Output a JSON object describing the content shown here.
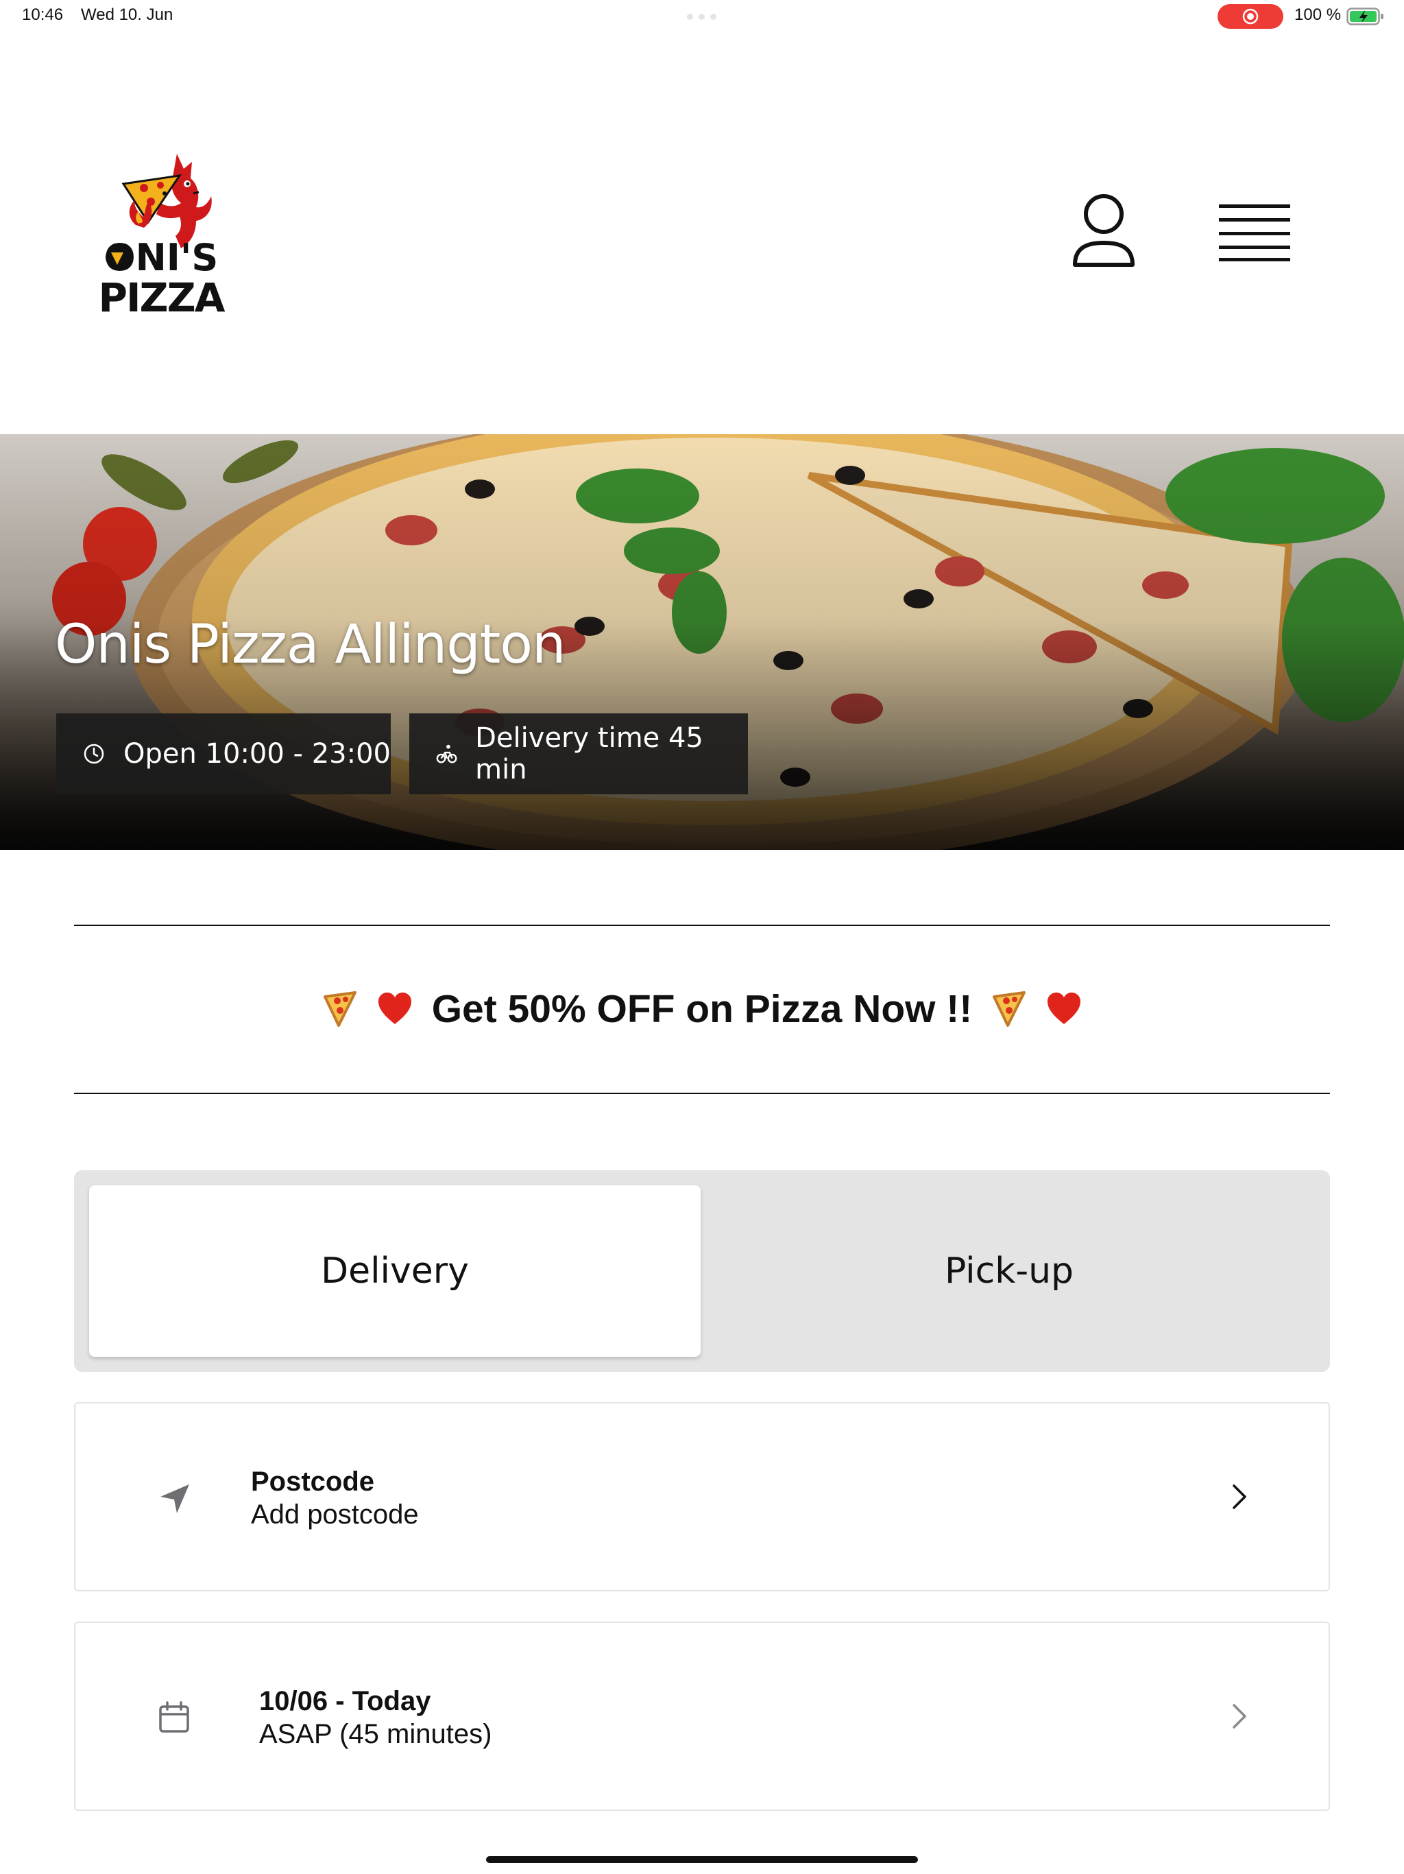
{
  "status_bar": {
    "time": "10:46",
    "date": "Wed 10. Jun",
    "battery": "100 %",
    "recording_color": "#ef3b36",
    "battery_color": "#34c759"
  },
  "header": {
    "logo_text": "ONI'S PIZZA",
    "logo_color": "#d0191b"
  },
  "hero": {
    "title": "Onis Pizza Allington",
    "hours": "Open 10:00 - 23:00",
    "delivery_time": "Delivery time 45 min",
    "hours_icon": "clock-icon",
    "delivery_icon": "bicycle-icon"
  },
  "promo": {
    "text": "Get 50% OFF on Pizza Now !!",
    "emoji_left": [
      "pizza-emoji",
      "heart-emoji"
    ],
    "emoji_right": [
      "pizza-emoji",
      "heart-emoji"
    ]
  },
  "order_mode": {
    "options": [
      "Delivery",
      "Pick-up"
    ],
    "selected": "Delivery"
  },
  "postcode": {
    "title": "Postcode",
    "value": "Add postcode",
    "icon": "location-arrow-icon"
  },
  "schedule": {
    "title": "10/06 - Today",
    "value": "ASAP (45 minutes)",
    "icon": "calendar-icon"
  }
}
